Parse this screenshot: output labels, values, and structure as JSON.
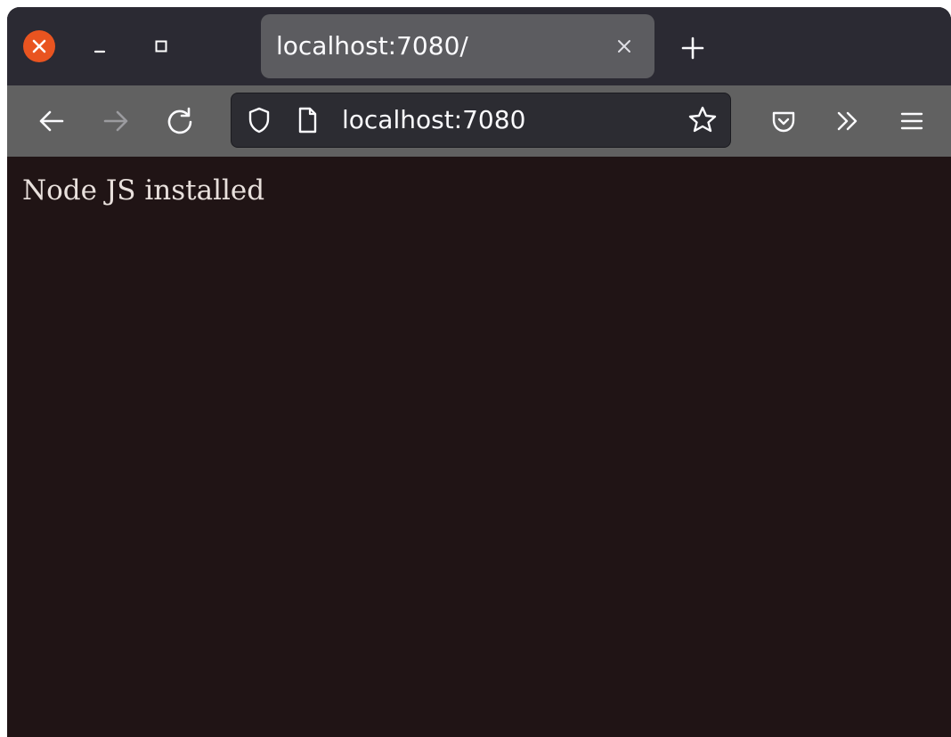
{
  "window": {
    "controls": {
      "close_icon": "close-icon",
      "minimize_icon": "minimize-icon",
      "maximize_icon": "maximize-icon"
    }
  },
  "tabs": [
    {
      "label": "localhost:7080/",
      "active": true
    }
  ],
  "navbar": {
    "url": "localhost:7080"
  },
  "page": {
    "body_text": "Node JS installed"
  },
  "colors": {
    "window_close": "#e95420",
    "titlebar": "#2b2a33",
    "tab_active": "#5c5c60",
    "navbar": "#616161",
    "urlbar": "#2c2c32",
    "content_bg": "#201415",
    "content_text": "#e8e0dc"
  }
}
